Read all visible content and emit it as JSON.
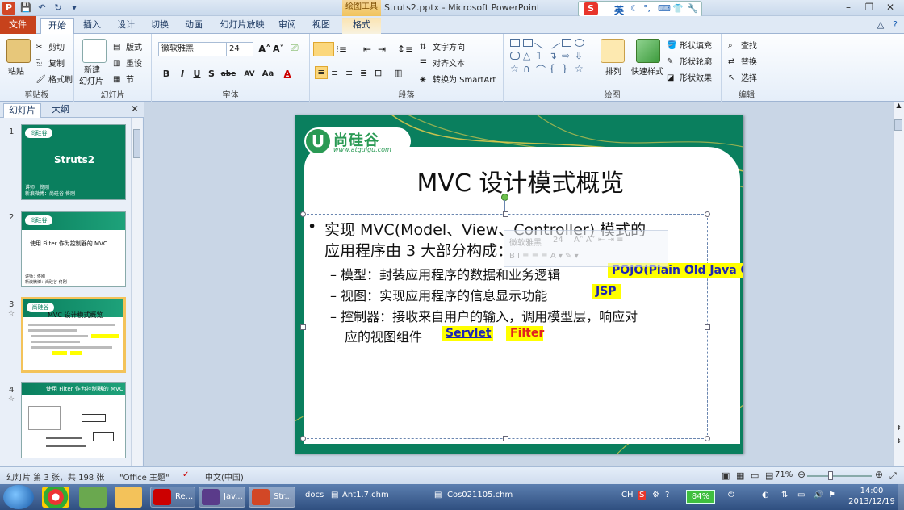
{
  "window": {
    "title": "Struts2.pptx - Microsoft PowerPoint",
    "context_tab_group": "绘图工具",
    "ime_lang": "英"
  },
  "ribbon_tabs": [
    "文件",
    "开始",
    "插入",
    "设计",
    "切换",
    "动画",
    "幻灯片放映",
    "审阅",
    "视图",
    "格式"
  ],
  "ribbon": {
    "clipboard": {
      "paste": "粘贴",
      "cut": "剪切",
      "copy": "复制",
      "format_painter": "格式刷",
      "label": "剪贴板"
    },
    "slides": {
      "new_slide_1": "新建",
      "new_slide_2": "幻灯片",
      "layout": "版式",
      "reset": "重设",
      "section": "节",
      "label": "幻灯片"
    },
    "font": {
      "name": "微软雅黑",
      "size": "24",
      "label": "字体"
    },
    "paragraph": {
      "text_direction": "文字方向",
      "align_text": "对齐文本",
      "smartart": "转换为 SmartArt",
      "label": "段落"
    },
    "drawing": {
      "arrange": "排列",
      "quick_styles": "快速样式",
      "shape_fill": "形状填充",
      "shape_outline": "形状轮廓",
      "shape_effects": "形状效果",
      "label": "绘图"
    },
    "editing": {
      "find": "查找",
      "replace": "替换",
      "select": "选择",
      "label": "编辑"
    }
  },
  "left_pane": {
    "tab_slides": "幻灯片",
    "tab_outline": "大纲",
    "thumbs": [
      {
        "num": "1",
        "title": "Struts2",
        "line1": "讲师：佟刚",
        "line2": "新浪微博：尚硅谷-佟刚"
      },
      {
        "num": "2",
        "title": "使用 Filter 作为控制器的 MVC",
        "line1": "讲师：佟刚",
        "line2": "新浪微博：尚硅谷-佟刚"
      },
      {
        "num": "3",
        "title": "MVC 设计模式概览"
      },
      {
        "num": "4",
        "title": "使用 Filter 作为控制器的 MVC"
      }
    ]
  },
  "slide": {
    "logo_name": "尚硅谷",
    "logo_url": "www.atguigu.com",
    "title": "MVC 设计模式概览",
    "bullet_line1": "实现 MVC(Model、View、Controller) 模式的",
    "bullet_line2": "应用程序由 3 大部分构成：",
    "model_line": "– 模型：封装应用程序的数据和业务逻辑",
    "model_tag": "POJO(Plain Old Java Object)",
    "view_line": "– 视图：实现应用程序的信息显示功能",
    "view_tag": "JSP",
    "controller_line1": "– 控制器：接收来自用户的输入，调用模型层，响应对",
    "controller_line2": "应的视图组件",
    "controller_tag1": "Servlet",
    "controller_tag2": "Filter"
  },
  "mini_toolbar": {
    "font": "微软雅黑",
    "size": "24"
  },
  "status": {
    "slide_info": "幻灯片 第 3 张，共 198 张",
    "theme": "\"Office 主题\"",
    "language": "中文(中国)",
    "zoom": "71%"
  },
  "taskbar": {
    "items": [
      "Re...",
      "Jav...",
      "Str...",
      "docs",
      "Ant1.7.chm",
      "Cos021105.chm"
    ],
    "ime": "CH",
    "battery": "84%",
    "time": "14:00",
    "date": "2013/12/19"
  },
  "colors": {
    "ppt_orange": "#c7421c",
    "slide_green": "#0a7f5e",
    "highlight": "#ffff00",
    "tag_blue": "#1d24b4",
    "tag_red": "#e02020"
  }
}
